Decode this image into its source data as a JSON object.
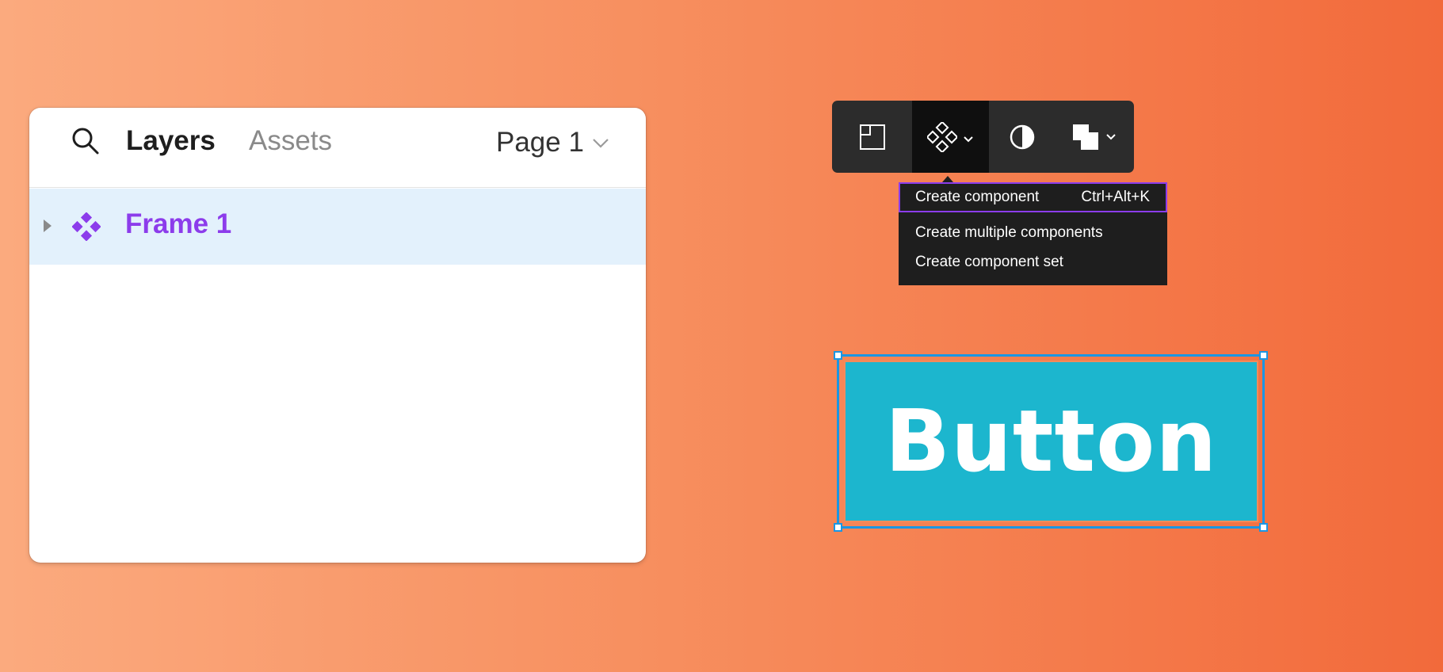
{
  "layers_panel": {
    "tabs": [
      {
        "label": "Layers",
        "active": true
      },
      {
        "label": "Assets",
        "active": false
      }
    ],
    "page_selector": {
      "value": "Page 1"
    },
    "layers": [
      {
        "name": "Frame 1",
        "icon": "component-icon",
        "selected": true,
        "collapsed": true
      }
    ],
    "colors": {
      "selected_row_bg": "#E3F1FC",
      "component_purple": "#8C3CEB"
    }
  },
  "toolbar": {
    "tools": [
      {
        "icon": "frame-icon",
        "label": "Frame"
      },
      {
        "icon": "component-icon",
        "label": "Component",
        "active": true,
        "has_dropdown": true
      },
      {
        "icon": "mask-icon",
        "label": "Mask"
      },
      {
        "icon": "boolean-union-icon",
        "label": "Boolean",
        "has_dropdown": true
      }
    ]
  },
  "component_menu": {
    "items": [
      {
        "label": "Create component",
        "shortcut": "Ctrl+Alt+K",
        "highlighted": true
      },
      {
        "label": "Create multiple components",
        "shortcut": ""
      },
      {
        "label": "Create component set",
        "shortcut": ""
      }
    ]
  },
  "canvas": {
    "button": {
      "label": "Button",
      "fill": "#1CB6CE",
      "text_color": "#FFFFFF"
    },
    "selection_color": "#1B96E3"
  }
}
